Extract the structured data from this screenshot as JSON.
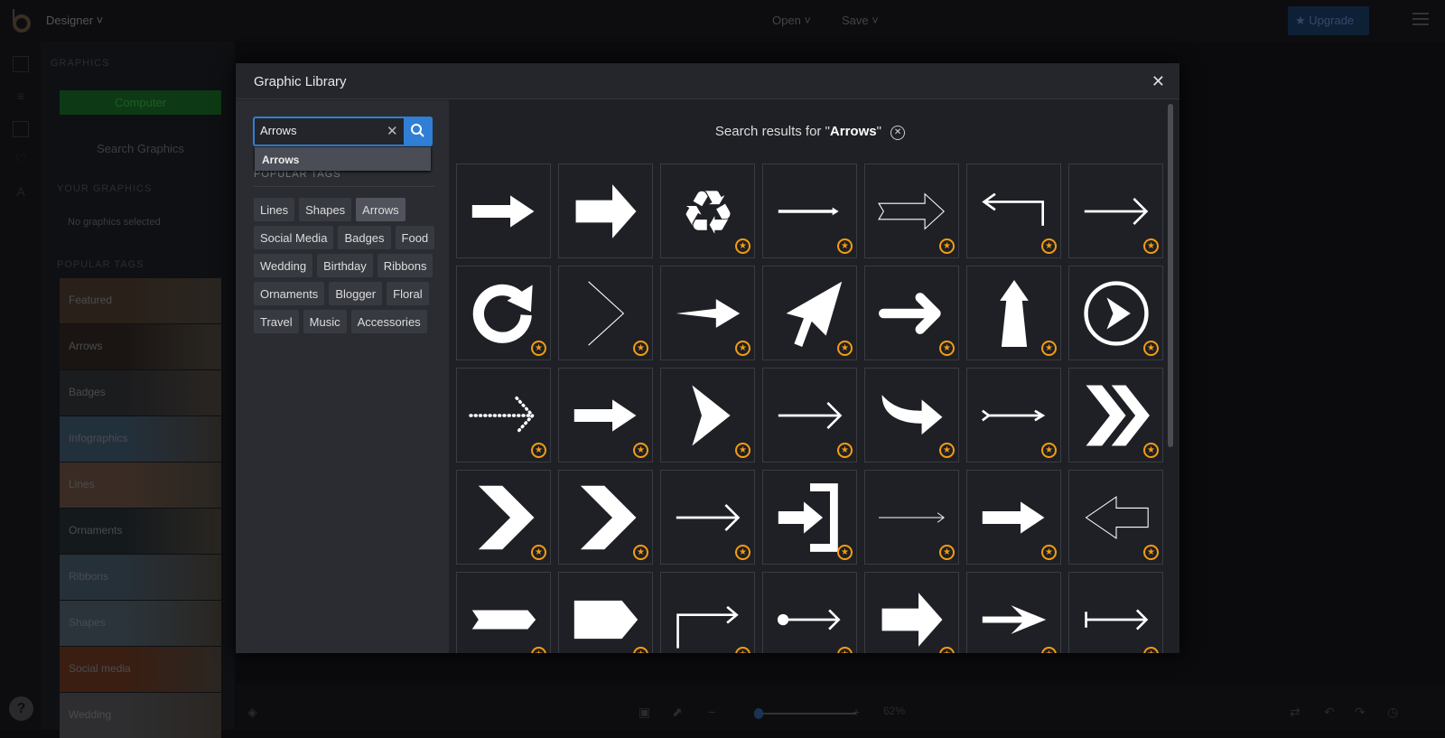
{
  "topbar": {
    "app_menu": "Designer",
    "open": "Open",
    "save": "Save",
    "upgrade": "Upgrade"
  },
  "sidebar": {
    "heading": "GRAPHICS",
    "computer": "Computer",
    "search_graphics": "Search Graphics",
    "your_graphics": "YOUR GRAPHICS",
    "no_graphics": "No graphics selected",
    "popular_tags": "POPULAR TAGS",
    "tag_cards": [
      "Featured",
      "Arrows",
      "Badges",
      "Infographics",
      "Lines",
      "Ornaments",
      "Ribbons",
      "Shapes",
      "Social media",
      "Wedding"
    ],
    "tag_colors": [
      "#2a201a",
      "#1a1512",
      "#1b1c1e",
      "#22303c",
      "#3a2c24",
      "#14191c",
      "#263038",
      "#2b343a",
      "#3a1e12",
      "#2e2e30"
    ]
  },
  "bottombar": {
    "zoom_level": "62%",
    "zoom_fraction": 0.1
  },
  "modal": {
    "title": "Graphic Library",
    "search": {
      "value": "Arrows",
      "suggestion": "Arrows"
    },
    "popular_tags_heading": "POPULAR TAGS",
    "tags": [
      "Lines",
      "Shapes",
      "Arrows",
      "Social Media",
      "Badges",
      "Food",
      "Wedding",
      "Birthday",
      "Ribbons",
      "Ornaments",
      "Blogger",
      "Floral",
      "Travel",
      "Music",
      "Accessories"
    ],
    "active_tag": "Arrows",
    "results_prefix": "Search results for \"",
    "results_query": "Arrows",
    "results_suffix": "\"",
    "results": [
      {
        "icon": "block-arrow",
        "premium": false
      },
      {
        "icon": "bold-block-arrow",
        "premium": false
      },
      {
        "icon": "recycle",
        "premium": true
      },
      {
        "icon": "thin-line-arrow",
        "premium": true
      },
      {
        "icon": "outline-arrow",
        "premium": true
      },
      {
        "icon": "return-arrow",
        "premium": true
      },
      {
        "icon": "open-line-arrow",
        "premium": true
      },
      {
        "icon": "circular-arrow",
        "premium": true
      },
      {
        "icon": "thin-chevron",
        "premium": true
      },
      {
        "icon": "dart-arrow",
        "premium": true
      },
      {
        "icon": "cursor-arrow",
        "premium": true
      },
      {
        "icon": "rounded-arrow",
        "premium": true
      },
      {
        "icon": "up-arrow",
        "premium": true
      },
      {
        "icon": "circle-play-arrow",
        "premium": true
      },
      {
        "icon": "dotted-arrow",
        "premium": true
      },
      {
        "icon": "block-arrow",
        "premium": true
      },
      {
        "icon": "arrowhead",
        "premium": true
      },
      {
        "icon": "open-line-arrow",
        "premium": true
      },
      {
        "icon": "curved-arrow",
        "premium": true
      },
      {
        "icon": "feather-arrow",
        "premium": true
      },
      {
        "icon": "double-chevron",
        "premium": true
      },
      {
        "icon": "chevron",
        "premium": true
      },
      {
        "icon": "chevron",
        "premium": true
      },
      {
        "icon": "open-line-arrow",
        "premium": true
      },
      {
        "icon": "enter-arrow",
        "premium": true
      },
      {
        "icon": "hairline-arrow",
        "premium": true
      },
      {
        "icon": "block-arrow",
        "premium": true
      },
      {
        "icon": "outline-left-arrow",
        "premium": true
      },
      {
        "icon": "tag-arrow",
        "premium": true
      },
      {
        "icon": "pentagon-arrow",
        "premium": true
      },
      {
        "icon": "corner-arrow",
        "premium": true
      },
      {
        "icon": "dot-arrow",
        "premium": true
      },
      {
        "icon": "bold-block-arrow",
        "premium": true
      },
      {
        "icon": "barbed-arrow",
        "premium": true
      },
      {
        "icon": "bar-arrow",
        "premium": true
      }
    ]
  }
}
